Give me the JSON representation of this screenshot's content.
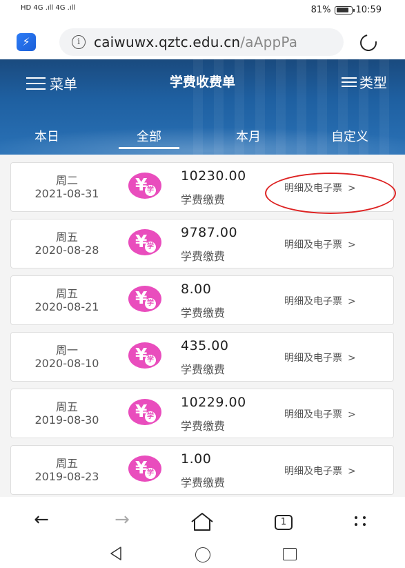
{
  "status_bar": {
    "network_left": "HD 4G .ıll 4G .ıll",
    "battery_text": "81%",
    "time": "10:59"
  },
  "browser": {
    "url_host": "caiwuwx.qztc.edu.cn",
    "url_path": "/aAppPa",
    "info_icon_glyph": "i",
    "tab_count": "1",
    "app_icon_glyph": "⚡"
  },
  "header": {
    "menu_label": "菜单",
    "title": "学费收费单",
    "type_label": "类型",
    "background_color": "#1e5fa0"
  },
  "tabs": [
    {
      "label": "本日",
      "active": false
    },
    {
      "label": "全部",
      "active": true
    },
    {
      "label": "本月",
      "active": false
    },
    {
      "label": "自定义",
      "active": false
    }
  ],
  "records": [
    {
      "weekday": "周二",
      "date": "2021-08-31",
      "amount": "10230.00",
      "desc": "学费缴费",
      "detail": "明细及电子票",
      "arrow": ">",
      "circled": true
    },
    {
      "weekday": "周五",
      "date": "2020-08-28",
      "amount": "9787.00",
      "desc": "学费缴费",
      "detail": "明细及电子票",
      "arrow": ">",
      "circled": false
    },
    {
      "weekday": "周五",
      "date": "2020-08-21",
      "amount": "8.00",
      "desc": "学费缴费",
      "detail": "明细及电子票",
      "arrow": ">",
      "circled": false
    },
    {
      "weekday": "周一",
      "date": "2020-08-10",
      "amount": "435.00",
      "desc": "学费缴费",
      "detail": "明细及电子票",
      "arrow": ">",
      "circled": false
    },
    {
      "weekday": "周五",
      "date": "2019-08-30",
      "amount": "10229.00",
      "desc": "学费缴费",
      "detail": "明细及电子票",
      "arrow": ">",
      "circled": false
    },
    {
      "weekday": "周五",
      "date": "2019-08-23",
      "amount": "1.00",
      "desc": "学费缴费",
      "detail": "明细及电子票",
      "arrow": ">",
      "circled": false
    }
  ],
  "coin_icon": {
    "yen": "¥",
    "label": "学",
    "color": "#e94dbd"
  },
  "toolbar": {
    "back_glyph": "←",
    "forward_glyph": "→"
  }
}
